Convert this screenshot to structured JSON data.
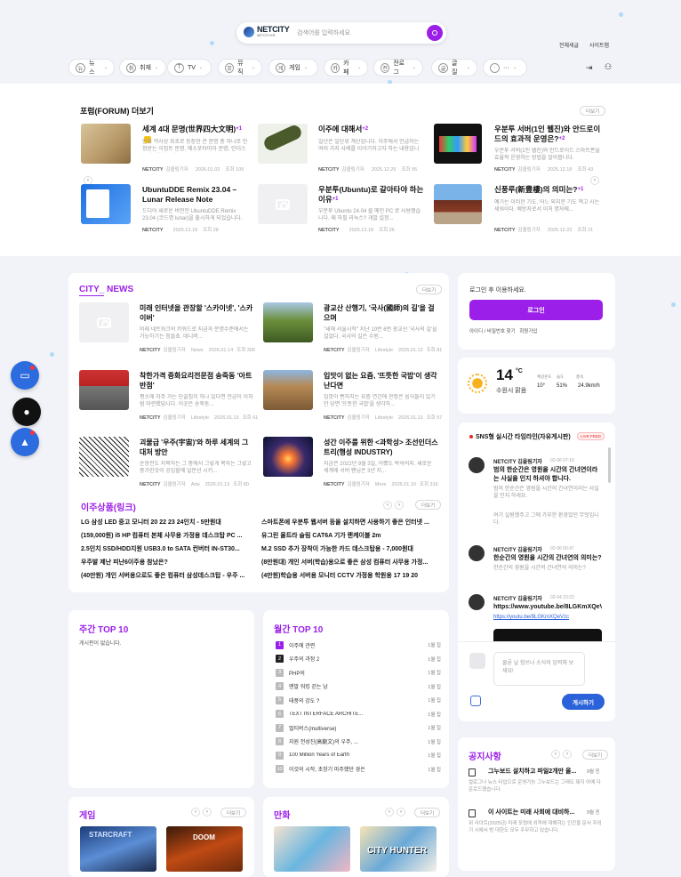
{
  "header": {
    "logo_text": "NETCITY",
    "logo_sub": "NETCITY.KR",
    "search_placeholder": "검색어를 입력하세요",
    "links": [
      "전체세글",
      "사이트맵"
    ]
  },
  "nav": {
    "items": [
      {
        "label": "뉴스",
        "icon": "뉴"
      },
      {
        "label": "취재",
        "icon": "취"
      },
      {
        "label": "TV",
        "icon": "T"
      },
      {
        "label": "뮤직",
        "icon": "뮤"
      },
      {
        "label": "게임",
        "icon": "게"
      },
      {
        "label": "카페",
        "icon": "카"
      },
      {
        "label": "전로그",
        "icon": "전"
      },
      {
        "label": "글질",
        "icon": "글"
      },
      {
        "label": "···",
        "icon": "·"
      }
    ]
  },
  "forum": {
    "title": "포럼(FORUM) 더보기",
    "more": "더보기",
    "items": [
      {
        "title": "세계 4대 문명(世界四大文明)",
        "count": "+1",
        "badge": true,
        "desc": "인류 역사상 최초로 등장한 큰 문명 중 하나로 인정받는 이집트 문명, 메소포타미아 문명, 인더스 문명, 황하 문명...",
        "author": "NETCITY",
        "role": "김올림기자",
        "date": "2026.01.02",
        "views": "조회 109"
      },
      {
        "title": "이주에 대해서",
        "count": "+2",
        "badge": false,
        "desc": "일년은 일단위 계산입니다. 이주에서 언급하는 여러 가지 사례를 이야기하고자 하는 내용입니다.",
        "author": "NETCITY",
        "role": "김올림기자",
        "date": "2025.12.29",
        "views": "조회 95"
      },
      {
        "title": "우분투 서버(1인 웹진)와 안드로이드의 효과적 운영은?",
        "count": "+2",
        "badge": false,
        "desc": "우분투 서버(1인 웹진)와 안드로이드 스마트폰을 효율적 운영하는 방법을 알아봅니다.",
        "author": "NETCITY",
        "role": "김올림기자",
        "date": "2025.12.18",
        "views": "조회 43"
      },
      {
        "title": "UbuntuDDE Remix 23.04 – Lunar Release Note",
        "count": "",
        "badge": false,
        "desc": "드디어 새로운 버전인 UbuntuDDE Remix 23.04 (코드명 lunar)을 출시하게 되었습니다.",
        "author": "NETCITY",
        "role": "",
        "date": "2025.12.18",
        "views": "조회 28"
      },
      {
        "title": "우분투(Ubuntu)로 갈아타야 하는 이유",
        "count": "+1",
        "badge": false,
        "desc": "우분투 Ubuntu 24.04 를 메인 PC 로 사용했습니다. 왜 하필 리눅스? 개발 설정...",
        "author": "NETCITY",
        "role": "",
        "date": "2025.12.18",
        "views": "조회 26"
      },
      {
        "title": "신풍루(新豊樓)의 의미는?",
        "count": "+1",
        "badge": false,
        "desc": "예기는 이러한 기도, 어느 외지문 기도 책고 사는 세워이다. 예방자로서 이처 명자에...",
        "author": "NETCITY",
        "role": "김올림기자",
        "date": "2025.12.23",
        "views": "조회 21"
      }
    ]
  },
  "city_news": {
    "title": "CITY_ NEWS",
    "more": "더보기",
    "items": [
      {
        "title": "미래 인터넷을 관장할 '스카이넷', '스카이버'",
        "desc": "미래 네트워크의 키워드로 지금과 문명수준에서는 가능하기는 힘들죠. 데니버...",
        "author": "NETCITY",
        "role": "김올림기자",
        "cat": "News",
        "date": "2026.01.14",
        "views": "조회 300"
      },
      {
        "title": "광교산 산행기, '국사(國師)의 길'을 걸으며",
        "desc": "\"새해 서울시작\" 지난 10번 6번 광교산 '국사의 길'을 걸었다. 국사의 길은 수원...",
        "author": "NETCITY",
        "role": "김올림기자",
        "cat": "Lifestyle",
        "date": "2026.01.13",
        "views": "조회 81"
      },
      {
        "title": "착한가격 중화요리전문점 송죽동 '아트반점'",
        "desc": "평소에 자주 가는 단골집이 하나 있다면 언급이 이처럼 마련했답니다. 이곳은 송죽동...",
        "author": "NETCITY",
        "role": "김올림기자",
        "cat": "Lifestyle",
        "date": "2026.01.13",
        "views": "조회 61"
      },
      {
        "title": "입맛이 없는 요즘, '뜨뜻한 국밥'이 생각난다면",
        "desc": "입맛이 뻔하지는 요즘 연간에 관정은 음식들이 있기만 당면 '뜨뜻한 국밥'을 생각하...",
        "author": "NETCITY",
        "role": "김올림기자",
        "cat": "Lifestyle",
        "date": "2026.01.13",
        "views": "조회 57"
      },
      {
        "title": "괴물급 '우주(宇宙)'와 하루 세계의 그 대처 방안",
        "desc": "순항전도 지목하는 그 중에서 그렇게 목하는 그렇고 중가한것이 공입할에 일문선 시키...",
        "author": "NETCITY",
        "role": "김올림기자",
        "cat": "Arts",
        "date": "2026.01.13",
        "views": "조회 80"
      },
      {
        "title": "성간 이주를 위한 <과학성> 조선인더스트리(행성 INDUSTRY)",
        "desc": "지금은 2022년 9월 3일, 어쨌도 박석의지. 새로운 세계에 서버 팬님은 3년 지...",
        "author": "NETCITY",
        "role": "김올림기자",
        "cat": "More",
        "date": "2026.01.10",
        "views": "조회 316"
      }
    ]
  },
  "links": {
    "title": "이주상품(링크)",
    "more": "더보기",
    "left": [
      "LG 삼성 LED 중고 모니터 20 22 23 24인치 - 5만원대",
      "(159,000원) i5 HP 컴퓨터 본체 사무용 가정용 데스크탑 PC ...",
      "2.5인치 SSD/HDD지원 USB3.0 to SATA 컨버터 IN-ST30...",
      "우주발 제난 피난6이주용 참났은?",
      "(40만원) 개인 서버용으로도 좋은 컴퓨터 삼성데스크탑 - 우주 ..."
    ],
    "right": [
      "스마트폰에 우분투 웹서버 등을 설치하면 사용하기 좋은 인터넷 ...",
      "유그린 울트라 슬림 CAT6A 기가 랜케이블 2m",
      "M.2 SSD 추가 장착이 가능한 카드 데스크탑용 - 7,000원대",
      "(8만원대) 개인 서버(학습)용으로 좋은 삼성 컴퓨터 사무용 가정...",
      "(4만원)학습용 서버용 모니터 CCTV 가정용 학원용 17 19 20"
    ]
  },
  "weekly": {
    "title": "주간 TOP 10",
    "empty": "게시판이 없습니다."
  },
  "monthly": {
    "title": "월간 TOP 10",
    "items": [
      {
        "rank": "1",
        "title": "이주에 관련",
        "date": "1월 집"
      },
      {
        "rank": "2",
        "title": "우주의 과정 2",
        "date": "1월 집"
      },
      {
        "rank": "3",
        "title": "PHP의",
        "date": "1월 집"
      },
      {
        "rank": "4",
        "title": "맨발 워킹 걷는 남",
        "date": "1월 집"
      },
      {
        "rank": "5",
        "title": "태풍의 강도 ?",
        "date": "1월 집"
      },
      {
        "rank": "6",
        "title": "TEXT INTERFACE ARCHITE...",
        "date": "1월 집"
      },
      {
        "rank": "7",
        "title": "멀티버스(multiverse)",
        "date": "1월 집"
      },
      {
        "rank": "8",
        "title": "지원 전성진(高龍文)의 우주, ...",
        "date": "1월 집"
      },
      {
        "rank": "9",
        "title": "100 Million Years of Earth",
        "date": "1월 집"
      },
      {
        "rank": "10",
        "title": "이것의 시작, 초창기 마주했던 경은",
        "date": "1월 집"
      }
    ]
  },
  "login": {
    "prompt": "로그인 후 이용하세요.",
    "button": "로그인",
    "links": "아이디 / 비밀번호 찾기   회원가입"
  },
  "weather": {
    "temp": "14",
    "unit": "°C",
    "desc": "수원시 맑음",
    "stats": [
      {
        "label": "체감온도",
        "value": "10°"
      },
      {
        "label": "습도",
        "value": "51%"
      },
      {
        "label": "풍속",
        "value": "24.9km/h"
      }
    ]
  },
  "sns": {
    "title": "SNS형 실시간 타임라인(자유게시판)",
    "live": "LIVE FEED",
    "messages": [
      {
        "name": "NETCITY 김올림기자",
        "time": "02-06 07:19",
        "body": "범의 한순간은 영원을 시간의 간녀연이라는 사실을 인지 하셔야 합니다.",
        "gray1": "범의 한순간은 영원을 시간의 간녀연이라는 사실을 인지 하세요.",
        "gray2": "여기 실원했주고 그에 가부한 환경었던 무엇입니다."
      },
      {
        "name": "NETCITY 김올림기자",
        "time": "02-06 00:47",
        "body": "한순간의 영원을 시간의 간녀연의 의미는?",
        "gray1": "한순간의 영원을 시간의 간녀연의 의미는?",
        "gray2": ""
      },
      {
        "name": "NETCITY 김올림기자",
        "time": "02-04 23:23",
        "body": "https://www.youtube.be/8LGKmXQeVzc",
        "gray1": "https://youtu.be/8LGKmXQeVzc",
        "gray2": ""
      }
    ],
    "input_placeholder": "물론 날 힘쓰나 소식의 입력해 보세요!",
    "post": "게시하기"
  },
  "notice": {
    "title": "공지사항",
    "more": "더보기",
    "items": [
      {
        "title": "그누보드 설치하고 파일2개만 올...",
        "date": "9월 진",
        "desc": "컬로그나 뉴스 타입으로 운영가능 그누보드는 그래도 돼지 아예 다운로드했습니다."
      },
      {
        "title": "이 사이트는 미래 사회에 대비하...",
        "date": "9월 진",
        "desc": "위 사이트(2025년) 미래 포럼에 외적에 대해하는 인간을 문서 주외기 시에서 방 대한도 모두 주무하고 있습니다."
      }
    ]
  },
  "game": {
    "title": "게임",
    "more": "더보기"
  },
  "comic": {
    "title": "만화",
    "more": "더보기"
  },
  "colors": {
    "accent": "#9b1fe8",
    "bg": "#f1f3f8"
  }
}
